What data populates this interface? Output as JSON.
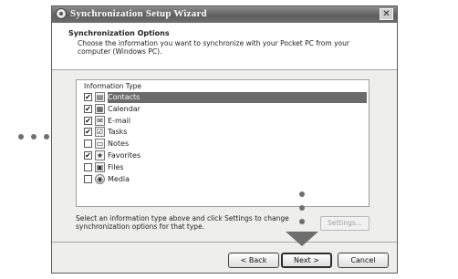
{
  "window": {
    "title": "Synchronization Setup Wizard",
    "close_label": "✕"
  },
  "header": {
    "title": "Synchronization Options",
    "description": "Choose the information you want to synchronize with your Pocket PC from your computer (Windows PC)."
  },
  "info_types": {
    "group_label": "Information Type",
    "items": [
      {
        "label": "Contacts",
        "checked": true,
        "selected": true,
        "icon": "contacts-icon"
      },
      {
        "label": "Calendar",
        "checked": true,
        "selected": false,
        "icon": "calendar-icon"
      },
      {
        "label": "E-mail",
        "checked": true,
        "selected": false,
        "icon": "email-icon"
      },
      {
        "label": "Tasks",
        "checked": true,
        "selected": false,
        "icon": "tasks-icon"
      },
      {
        "label": "Notes",
        "checked": false,
        "selected": false,
        "icon": "notes-icon"
      },
      {
        "label": "Favorites",
        "checked": true,
        "selected": false,
        "icon": "favorites-icon"
      },
      {
        "label": "Files",
        "checked": false,
        "selected": false,
        "icon": "files-icon"
      },
      {
        "label": "Media",
        "checked": false,
        "selected": false,
        "icon": "media-icon"
      }
    ]
  },
  "info_text": "Select an information type above and click Settings to change synchronization options for that type.",
  "buttons": {
    "settings": "Settings...",
    "back": "< Back",
    "next": "Next >",
    "cancel": "Cancel"
  }
}
